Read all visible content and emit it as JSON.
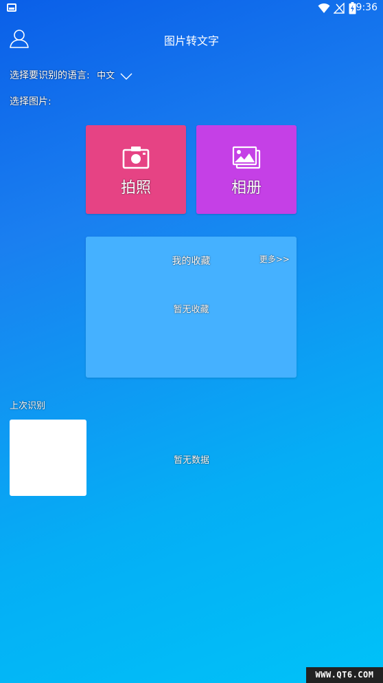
{
  "status_bar": {
    "time": "9:36"
  },
  "header": {
    "title": "图片转文字",
    "user_icon": "user-icon"
  },
  "language": {
    "label": "选择要识别的语言:",
    "value": "中文"
  },
  "select_image": {
    "label": "选择图片:"
  },
  "tiles": [
    {
      "label": "拍照",
      "icon": "camera-icon",
      "color": "#e64384"
    },
    {
      "label": "相册",
      "icon": "gallery-icon",
      "color": "#c540e6"
    }
  ],
  "favorites": {
    "title": "我的收藏",
    "more_label": "更多>>",
    "empty_text": "暂无收藏"
  },
  "last_recognition": {
    "label": "上次识别",
    "empty_text": "暂无数据"
  },
  "watermark": {
    "text": "WWW.QT6.COM"
  }
}
